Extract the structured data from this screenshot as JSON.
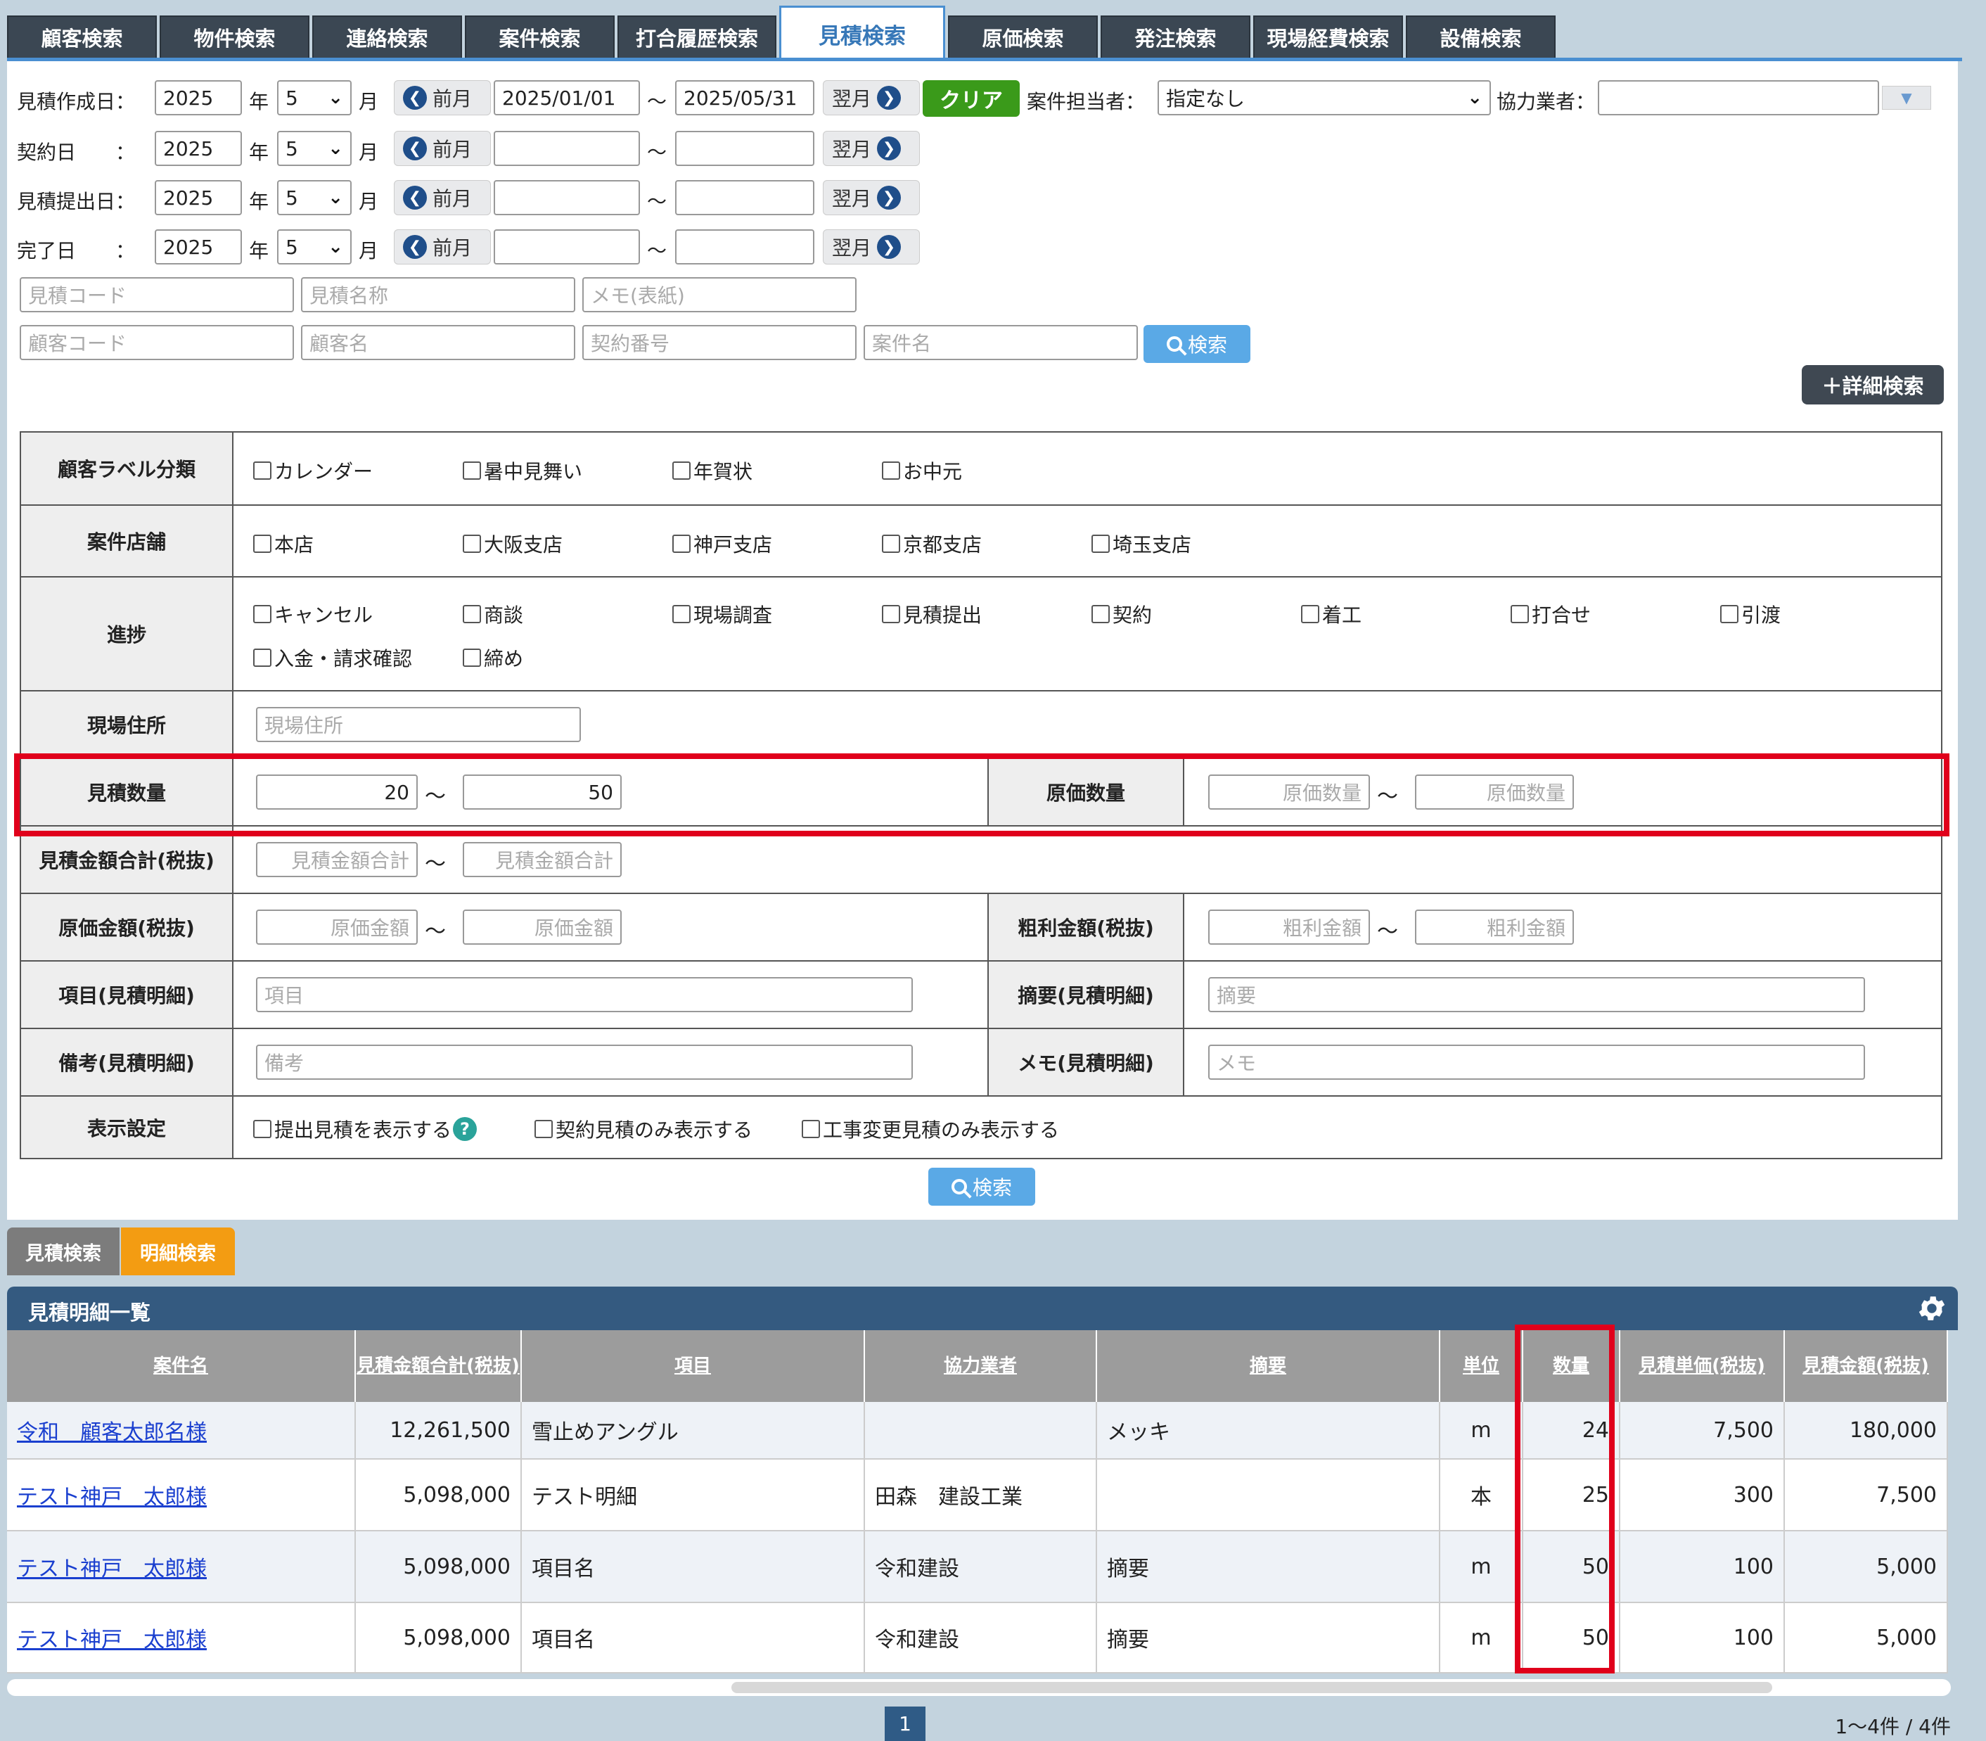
{
  "tabs": [
    {
      "label": "顧客検索"
    },
    {
      "label": "物件検索"
    },
    {
      "label": "連絡検索"
    },
    {
      "label": "案件検索"
    },
    {
      "label": "打合履歴検索"
    },
    {
      "label": "見積検索"
    },
    {
      "label": "原価検索"
    },
    {
      "label": "発注検索"
    },
    {
      "label": "現場経費検索"
    },
    {
      "label": "設備検索"
    }
  ],
  "active_tab": "見積検索",
  "dates": {
    "year_unit": "年",
    "month_unit": "月",
    "prev": "前月",
    "next": "翌月",
    "tilde": "～",
    "rows": [
      {
        "label": "見積作成日：",
        "year": "2025",
        "month": "5",
        "from": "2025/01/01",
        "to": "2025/05/31"
      },
      {
        "label": "契約日　　：",
        "year": "2025",
        "month": "5",
        "from": "",
        "to": ""
      },
      {
        "label": "見積提出日：",
        "year": "2025",
        "month": "5",
        "from": "",
        "to": ""
      },
      {
        "label": "完了日　　：",
        "year": "2025",
        "month": "5",
        "from": "",
        "to": ""
      }
    ]
  },
  "clear_label": "クリア",
  "staff": {
    "label": "案件担当者：",
    "value": "指定なし"
  },
  "partner": {
    "label": "協力業者：",
    "value": ""
  },
  "text_fields": {
    "estimate_code": "見積コード",
    "estimate_name": "見積名称",
    "memo_cover": "メモ(表紙)",
    "customer_code": "顧客コード",
    "customer_name": "顧客名",
    "contract_no": "契約番号",
    "project_name": "案件名"
  },
  "search_label": "検索",
  "detail_search_label": "＋詳細検索",
  "form": {
    "customer_label": {
      "head": "顧客ラベル分類",
      "options": [
        "カレンダー",
        "暑中見舞い",
        "年賀状",
        "お中元"
      ]
    },
    "store": {
      "head": "案件店舗",
      "options": [
        "本店",
        "大阪支店",
        "神戸支店",
        "京都支店",
        "埼玉支店"
      ]
    },
    "progress": {
      "head": "進捗",
      "options": [
        "キャンセル",
        "商談",
        "現場調査",
        "見積提出",
        "契約",
        "着工",
        "打合せ",
        "引渡",
        "入金・請求確認",
        "締め"
      ]
    },
    "site_address": {
      "head": "現場住所",
      "placeholder": "現場住所"
    },
    "estimate_qty": {
      "head": "見積数量",
      "from": "20",
      "to": "50"
    },
    "cost_qty": {
      "head": "原価数量",
      "placeholder": "原価数量"
    },
    "estimate_total": {
      "head": "見積金額合計(税抜)",
      "placeholder": "見積金額合計"
    },
    "cost_amount": {
      "head": "原価金額(税抜)",
      "placeholder": "原価金額"
    },
    "gross_profit": {
      "head": "粗利金額(税抜)",
      "placeholder": "粗利金額"
    },
    "item": {
      "head": "項目(見積明細)",
      "placeholder": "項目"
    },
    "summary": {
      "head": "摘要(見積明細)",
      "placeholder": "摘要"
    },
    "remarks": {
      "head": "備考(見積明細)",
      "placeholder": "備考"
    },
    "memo": {
      "head": "メモ(見積明細)",
      "placeholder": "メモ"
    },
    "display": {
      "head": "表示設定",
      "options": [
        "提出見積を表示する",
        "契約見積のみ表示する",
        "工事変更見積のみ表示する"
      ]
    }
  },
  "subtabs": [
    "見積検索",
    "明細検索"
  ],
  "list": {
    "title": "見積明細一覧",
    "columns": [
      "案件名",
      "見積金額合計(税抜)",
      "項目",
      "協力業者",
      "摘要",
      "単位",
      "数量",
      "見積単価(税抜)",
      "見積金額(税抜)"
    ],
    "rows": [
      {
        "project": "令和　顧客太郎名様",
        "total": "12,261,500",
        "item": "雪止めアングル",
        "partner": "",
        "summary": "メッキ",
        "unit": "m",
        "qty": "24",
        "price": "7,500",
        "amount": "180,000"
      },
      {
        "project": "テスト神戸　太郎様",
        "total": "5,098,000",
        "item": "テスト明細",
        "partner": "田森　建設工業",
        "summary": "",
        "unit": "本",
        "qty": "25",
        "price": "300",
        "amount": "7,500"
      },
      {
        "project": "テスト神戸　太郎様",
        "total": "5,098,000",
        "item": "項目名",
        "partner": "令和建設",
        "summary": "摘要",
        "unit": "m",
        "qty": "50",
        "price": "100",
        "amount": "5,000"
      },
      {
        "project": "テスト神戸　太郎様",
        "total": "5,098,000",
        "item": "項目名",
        "partner": "令和建設",
        "summary": "摘要",
        "unit": "m",
        "qty": "50",
        "price": "100",
        "amount": "5,000"
      }
    ]
  },
  "pagination": {
    "current": "1",
    "count": "1～4件 / 4件"
  },
  "colors": {
    "accent": "#4a8fd1",
    "highlight": "#e0001b",
    "clear": "#3a9a1a",
    "subtab_active": "#f39c12"
  }
}
